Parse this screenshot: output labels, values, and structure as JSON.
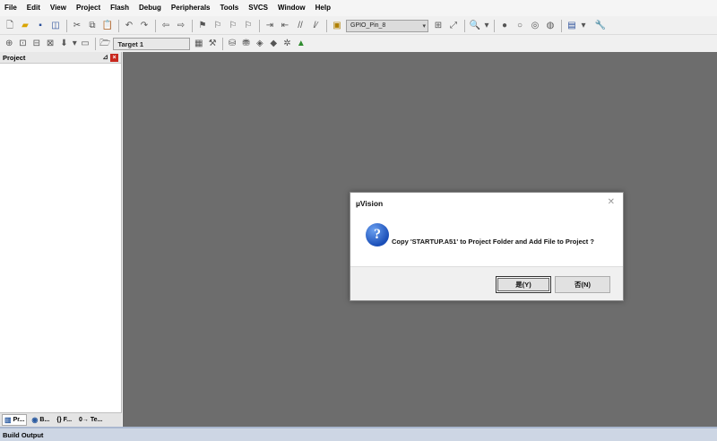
{
  "menu": [
    "File",
    "Edit",
    "View",
    "Project",
    "Flash",
    "Debug",
    "Peripherals",
    "Tools",
    "SVCS",
    "Window",
    "Help"
  ],
  "toolbar": {
    "target_combo": "GPIO_Pin_8",
    "target_name": "Target 1",
    "icons": [
      "new-file-icon",
      "open-folder-icon",
      "save-icon",
      "save-all-icon",
      "cut-icon",
      "copy-icon",
      "paste-icon",
      "undo-icon",
      "redo-icon",
      "nav-back-icon",
      "nav-forward-icon",
      "bookmark-icon",
      "bookmark-prev-icon",
      "bookmark-next-icon",
      "bookmark-clear-icon",
      "indent-icon",
      "unindent-icon",
      "comment-icon",
      "uncomment-icon",
      "find-in-files-icon",
      "find-icon",
      "debug-session-icon",
      "breakpoint-icon",
      "disable-breakpoint-icon",
      "kill-breakpoints-icon",
      "view-window-icon",
      "configure-icon"
    ]
  },
  "project_panel": {
    "title": "Project",
    "tabs": [
      {
        "label": "Pr...",
        "icon": "project-tab-icon"
      },
      {
        "label": "B...",
        "icon": "books-tab-icon"
      },
      {
        "label": "{} F...",
        "icon": "functions-tab-icon"
      },
      {
        "label": "0→ Te...",
        "icon": "templates-tab-icon"
      }
    ]
  },
  "build_output": {
    "title": "Build Output"
  },
  "dialog": {
    "title": "µVision",
    "message": "Copy 'STARTUP.A51' to Project Folder and Add File to Project ?",
    "yes_label": "是(Y)",
    "no_label": "否(N)",
    "icon": "question-icon"
  }
}
